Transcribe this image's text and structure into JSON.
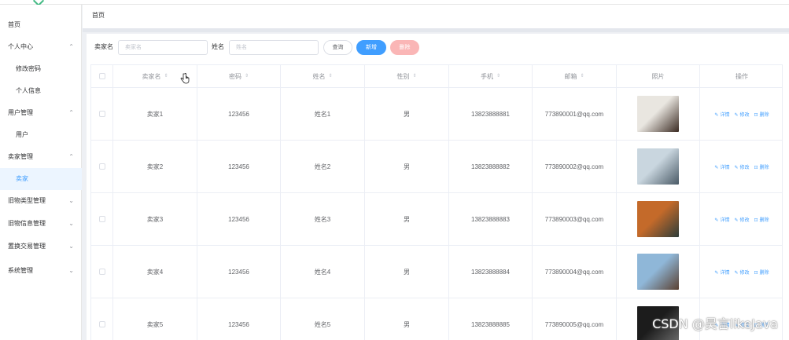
{
  "breadcrumb": "首页",
  "sidebar": {
    "items": [
      {
        "label": "首页",
        "type": "top",
        "chevron": ""
      },
      {
        "label": "个人中心",
        "type": "group",
        "chevron": "⌃"
      },
      {
        "label": "修改密码",
        "type": "sub",
        "chevron": ""
      },
      {
        "label": "个人信息",
        "type": "sub",
        "chevron": ""
      },
      {
        "label": "用户管理",
        "type": "group",
        "chevron": "⌃"
      },
      {
        "label": "用户",
        "type": "sub",
        "chevron": ""
      },
      {
        "label": "卖家管理",
        "type": "group",
        "chevron": "⌃"
      },
      {
        "label": "卖家",
        "type": "sub",
        "chevron": "",
        "active": true
      },
      {
        "label": "旧物类型管理",
        "type": "group",
        "chevron": "⌄"
      },
      {
        "label": "旧物信息管理",
        "type": "group",
        "chevron": "⌄"
      },
      {
        "label": "置换交易管理",
        "type": "group",
        "chevron": "⌄"
      },
      {
        "label": "系统管理",
        "type": "group",
        "chevron": "⌄"
      }
    ]
  },
  "search": {
    "seller_label": "卖家名",
    "seller_placeholder": "卖家名",
    "name_label": "姓名",
    "name_placeholder": "姓名",
    "query_btn": "查询",
    "add_btn": "新增",
    "delete_btn": "删除"
  },
  "table": {
    "columns": [
      "卖家名",
      "密码",
      "姓名",
      "性别",
      "手机",
      "邮箱",
      "照片",
      "操作"
    ],
    "sortable": [
      true,
      true,
      true,
      true,
      true,
      true,
      false,
      false
    ],
    "rows": [
      {
        "seller": "卖家1",
        "password": "123456",
        "name": "姓名1",
        "gender": "男",
        "phone": "13823888881",
        "email": "773890001@qq.com",
        "photo_colors": [
          "#e9e6e0",
          "#3a2a22"
        ]
      },
      {
        "seller": "卖家2",
        "password": "123456",
        "name": "姓名2",
        "gender": "男",
        "phone": "13823888882",
        "email": "773890002@qq.com",
        "photo_colors": [
          "#c9d6df",
          "#4a5a66"
        ]
      },
      {
        "seller": "卖家3",
        "password": "123456",
        "name": "姓名3",
        "gender": "男",
        "phone": "13823888883",
        "email": "773890003@qq.com",
        "photo_colors": [
          "#c46a2a",
          "#2d3d3a"
        ]
      },
      {
        "seller": "卖家4",
        "password": "123456",
        "name": "姓名4",
        "gender": "男",
        "phone": "13823888884",
        "email": "773890004@qq.com",
        "photo_colors": [
          "#8fb7d8",
          "#5a4030"
        ]
      },
      {
        "seller": "卖家5",
        "password": "123456",
        "name": "姓名5",
        "gender": "男",
        "phone": "13823888885",
        "email": "773890005@qq.com",
        "photo_colors": [
          "#1c1c1c",
          "#6a6a6a"
        ]
      }
    ],
    "ops": {
      "detail": "详情",
      "edit": "修改",
      "delete": "删除"
    }
  },
  "watermark": "CSDN @昊言likeJava",
  "colors": {
    "primary": "#409eff",
    "danger_disabled": "#fab6b6",
    "active_bg": "#ecf5ff"
  }
}
